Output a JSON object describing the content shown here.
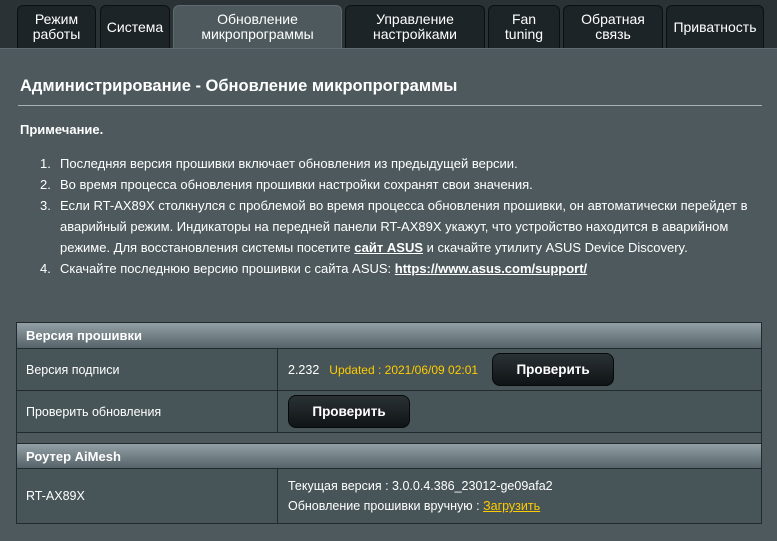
{
  "tabs": [
    {
      "label": "Режим\nработы",
      "active": false
    },
    {
      "label": "Система",
      "active": false
    },
    {
      "label": "Обновление\nмикропрограммы",
      "active": true
    },
    {
      "label": "Управление\nнастройками",
      "active": false
    },
    {
      "label": "Fan\ntuning",
      "active": false
    },
    {
      "label": "Обратная\nсвязь",
      "active": false
    },
    {
      "label": "Приватность",
      "active": false
    }
  ],
  "page": {
    "title": "Администрирование - Обновление микропрограммы",
    "note_label": "Примечание."
  },
  "notes": [
    {
      "num": "1.",
      "text": "Последняя версия прошивки включает обновления из предыдущей версии."
    },
    {
      "num": "2.",
      "text": "Во время процесса обновления прошивки настройки сохранят свои значения."
    },
    {
      "num": "3.",
      "text_before": "Если RT-AX89X столкнулся с проблемой во время процесса обновления прошивки, он автоматически перейдет в аварийный режим. Индикаторы на передней панели RT-AX89X укажут, что устройство находится в аварийном режиме. Для восстановления системы посетите ",
      "link": "сайт ASUS",
      "text_after": " и скачайте утилиту ASUS Device Discovery."
    },
    {
      "num": "4.",
      "text_before": "Скачайте последнюю версию прошивки с сайта ASUS: ",
      "link": "https://www.asus.com/support/"
    }
  ],
  "firmware": {
    "section_title": "Версия прошивки",
    "signature_label": "Версия подписи",
    "signature_version": "2.232",
    "signature_updated": "Updated : 2021/06/09 02:01",
    "check_button": "Проверить",
    "check_updates_label": "Проверить обновления",
    "check_updates_button": "Проверить"
  },
  "aimesh": {
    "section_title": "Роутер AiMesh",
    "device_name": "RT-AX89X",
    "current_version": "Текущая версия : 3.0.0.4.386_23012-ge09afa2",
    "manual_update_label": "Обновление прошивки вручную : ",
    "upload_link": "Загрузить"
  },
  "colors": {
    "panel": "#4d595d",
    "tab": "#1d2427",
    "accent_yellow": "#ffcc00"
  }
}
